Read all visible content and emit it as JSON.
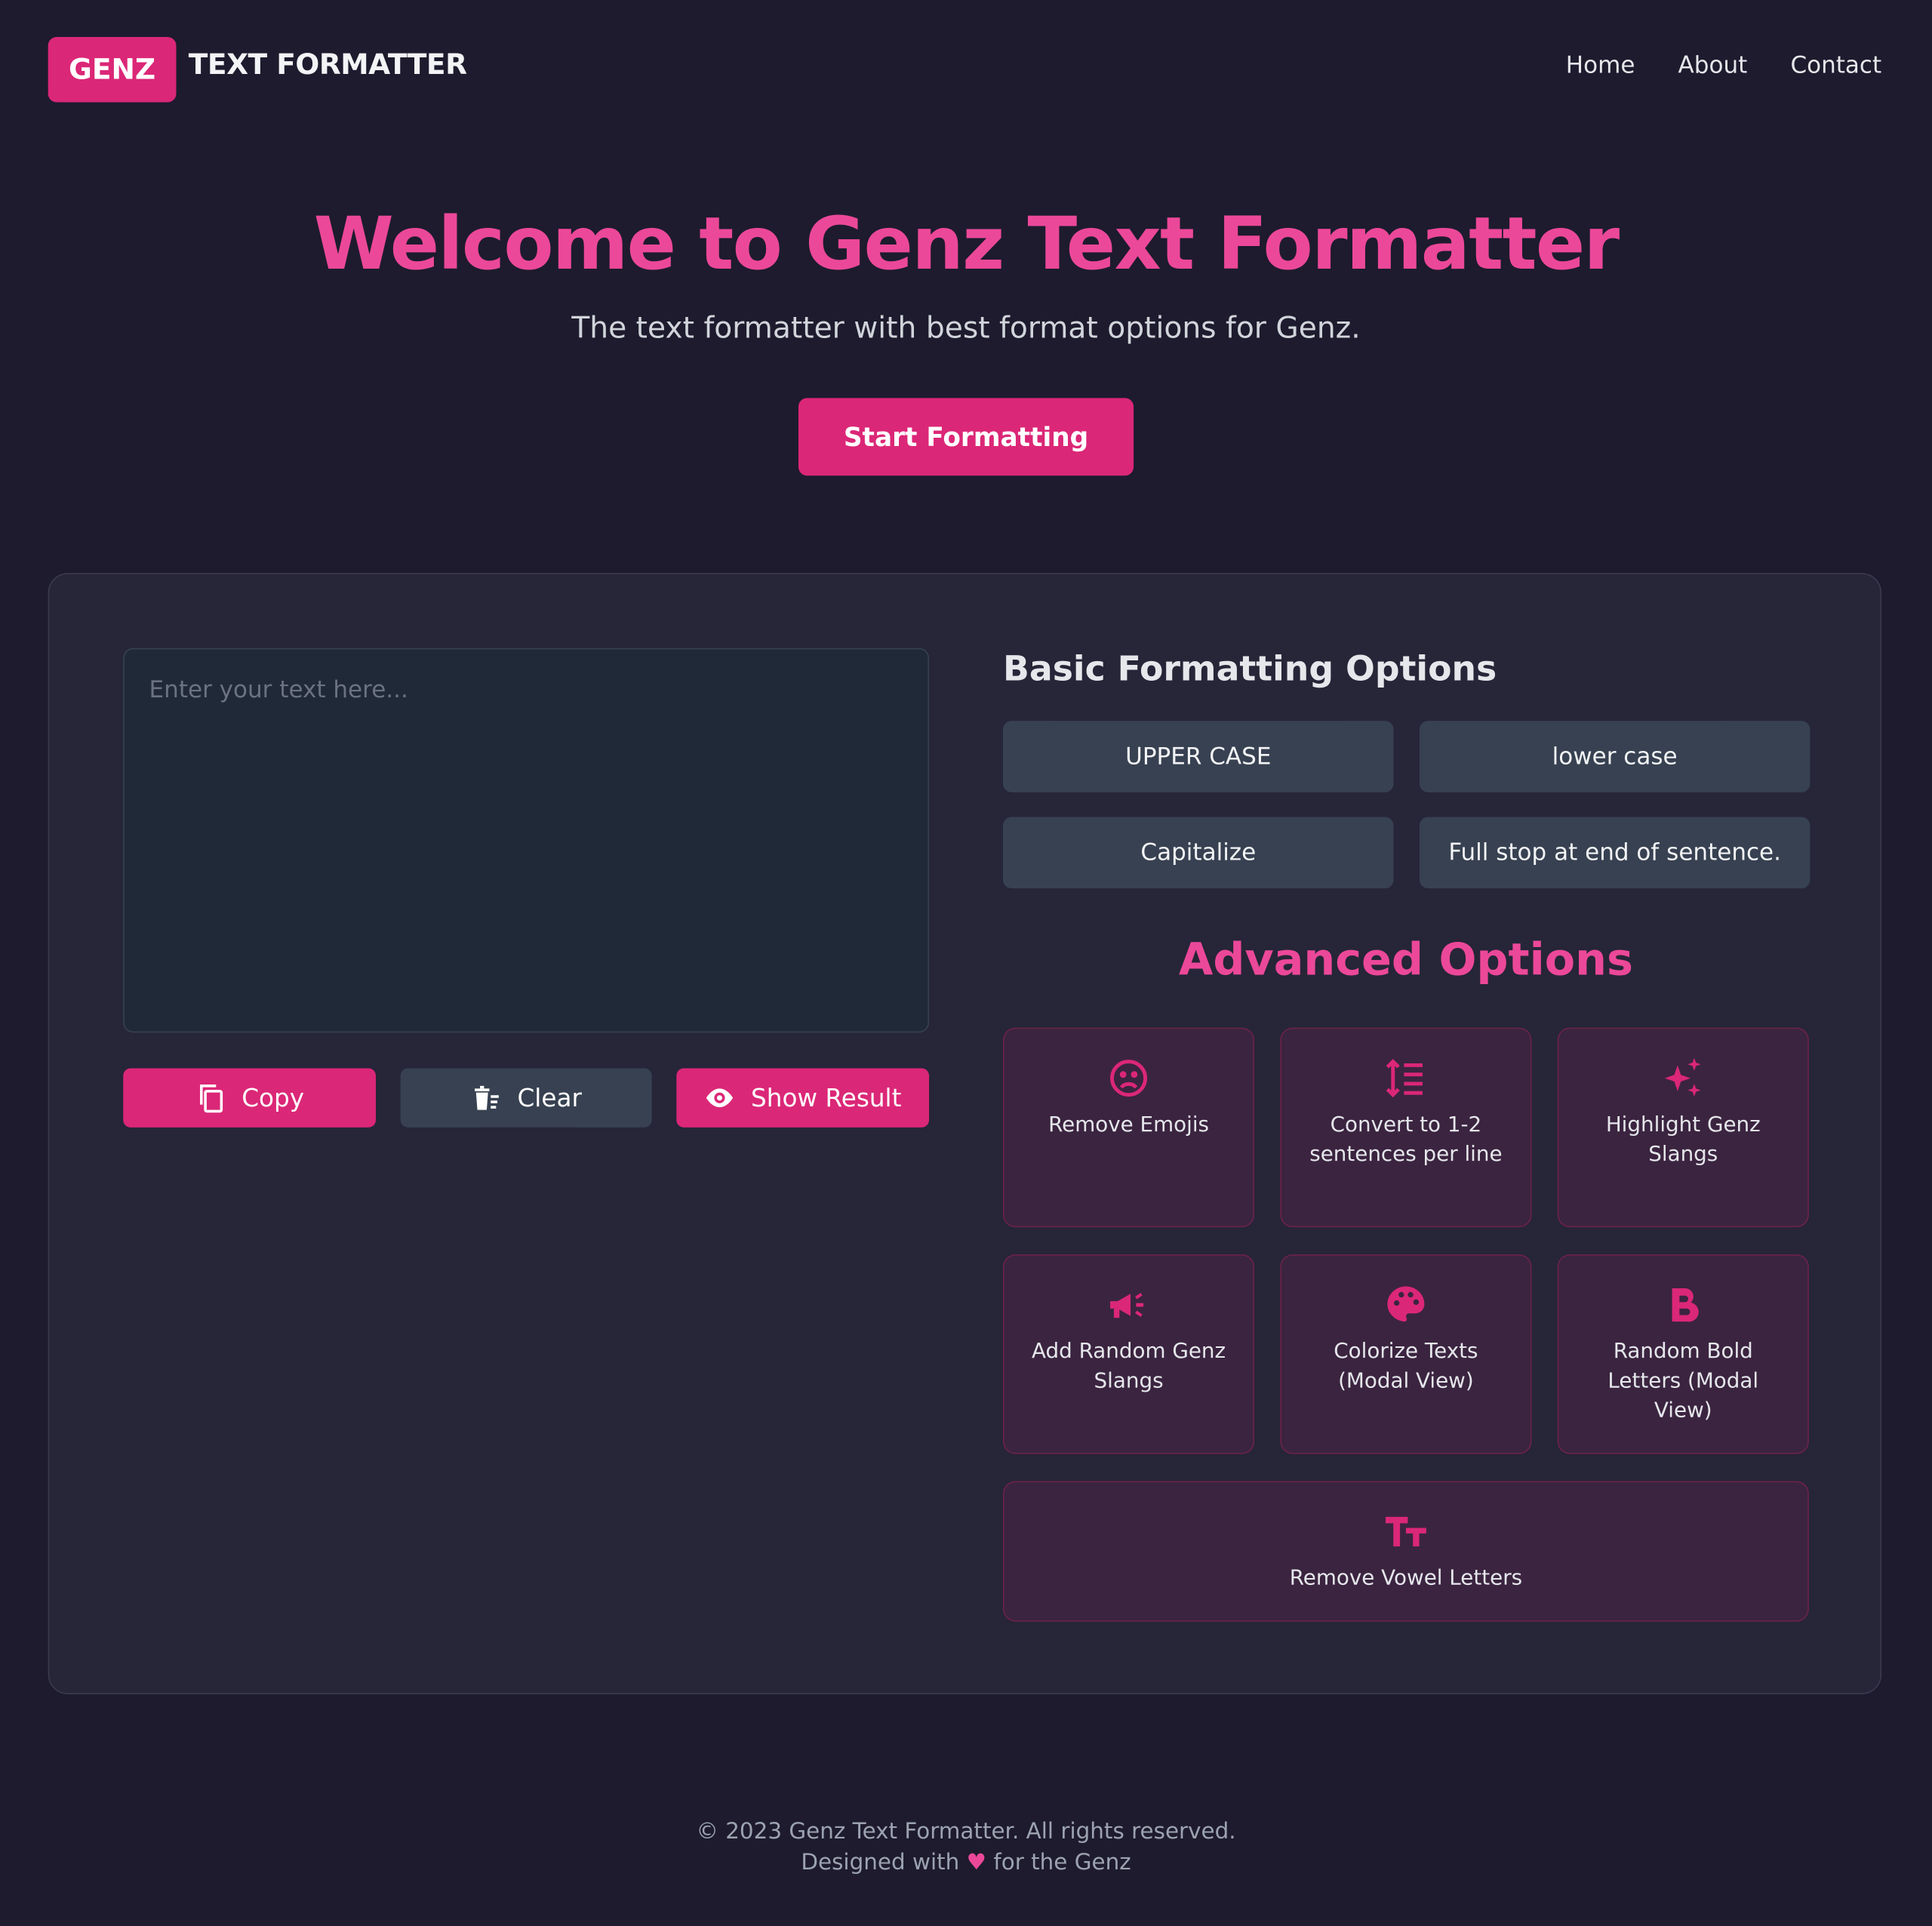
{
  "header": {
    "logo_badge": "GENZ",
    "logo_text": "TEXT FORMATTER",
    "nav": [
      "Home",
      "About",
      "Contact"
    ]
  },
  "hero": {
    "title": "Welcome to Genz Text Formatter",
    "subtitle": "The text formatter with best format options for Genz.",
    "cta_label": "Start Formatting"
  },
  "editor": {
    "placeholder": "Enter your text here...",
    "value": "",
    "copy_label": "Copy",
    "clear_label": "Clear",
    "show_result_label": "Show Result"
  },
  "basic": {
    "title": "Basic Formatting Options",
    "options": [
      "UPPER CASE",
      "lower case",
      "Capitalize",
      "Full stop at end of sentence."
    ]
  },
  "advanced": {
    "title": "Advanced Options",
    "options": [
      {
        "label": "Remove Emojis",
        "icon": "sad-face-icon"
      },
      {
        "label": "Convert to 1-2 sentences per line",
        "icon": "line-spacing-icon"
      },
      {
        "label": "Highlight Genz Slangs",
        "icon": "sparkles-icon"
      },
      {
        "label": "Add Random Genz Slangs",
        "icon": "megaphone-icon"
      },
      {
        "label": "Colorize Texts (Modal View)",
        "icon": "palette-icon"
      },
      {
        "label": "Random Bold Letters (Modal View)",
        "icon": "bold-icon"
      },
      {
        "label": "Remove Vowel Letters",
        "icon": "text-height-icon"
      }
    ]
  },
  "footer": {
    "copyright": "© 2023 Genz Text Formatter. All rights reserved.",
    "designed_prefix": "Designed with",
    "heart": "♥",
    "designed_suffix": "for the Genz"
  },
  "colors": {
    "background": "#1e1b2e",
    "accent": "#db2777",
    "accent_text": "#ec4899",
    "panel": "#272538",
    "button_slate": "#374151"
  }
}
